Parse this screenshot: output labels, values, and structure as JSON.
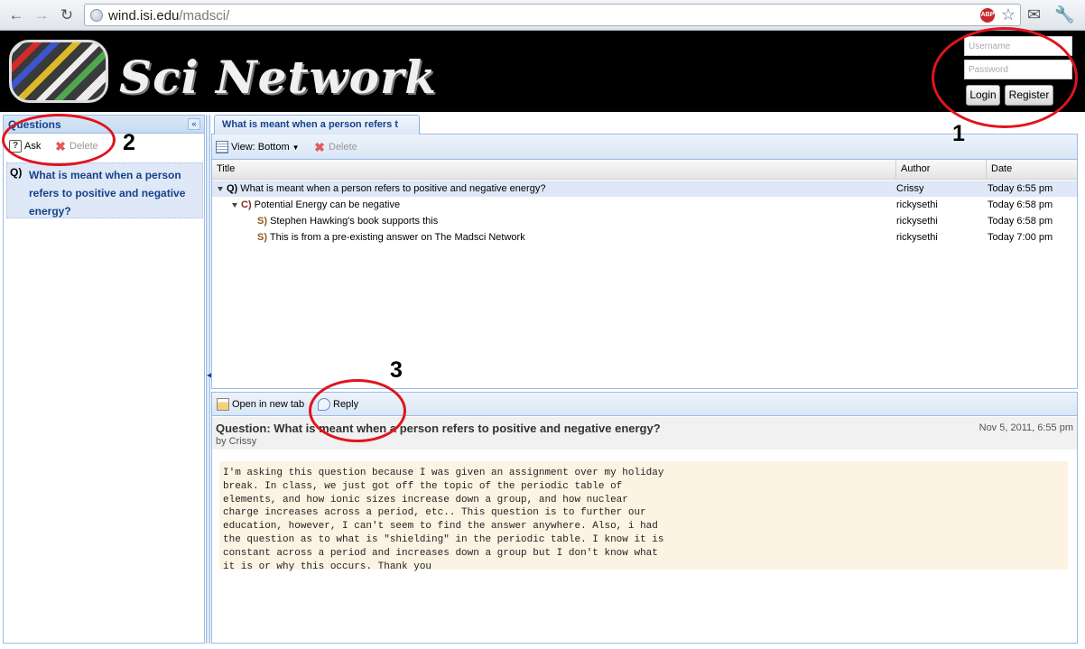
{
  "browser": {
    "url_host": "wind.isi.edu",
    "url_path": "/madsci/",
    "adblock_label": "ABP"
  },
  "banner": {
    "logo_text": "Sci Network",
    "username_placeholder": "Username",
    "password_placeholder": "Password",
    "login_label": "Login",
    "register_label": "Register"
  },
  "annotations": [
    "1",
    "2",
    "3"
  ],
  "left_panel": {
    "title": "Questions",
    "collapse_glyph": "«",
    "ask_label": "Ask",
    "delete_label": "Delete",
    "question_prefix": "Q)",
    "question_text": "What is meant when a person refers to positive and negative energy?"
  },
  "main": {
    "tab_label": "What is meant when a person refers t",
    "toolbar": {
      "view_label": "View: Bottom",
      "delete_label": "Delete"
    },
    "columns": [
      "Title",
      "Author",
      "Date"
    ],
    "rows": [
      {
        "prefix": "Q)",
        "title": "What is meant when a person refers to positive and negative energy?",
        "author": "Crissy",
        "date": "Today 6:55 pm"
      },
      {
        "prefix": "C)",
        "title": "Potential Energy can be negative",
        "author": "rickysethi",
        "date": "Today 6:58 pm"
      },
      {
        "prefix": "S)",
        "title": "Stephen Hawking's book supports this",
        "author": "rickysethi",
        "date": "Today 6:58 pm"
      },
      {
        "prefix": "S)",
        "title": "This is from a pre-existing answer on The Madsci Network",
        "author": "rickysethi",
        "date": "Today 7:00 pm"
      }
    ],
    "detail": {
      "open_tab_label": "Open in new tab",
      "reply_label": "Reply",
      "title": "Question: What is meant when a person refers to positive and negative energy?",
      "byline": "by Crissy",
      "date": "Nov 5, 2011, 6:55 pm",
      "body": "I'm asking this question because I was given an assignment over my holiday\nbreak. In class, we just got off the topic of the periodic table of\nelements, and how ionic sizes increase down a group, and how nuclear\ncharge increases across a period, etc.. This question is to further our\neducation, however, I can't seem to find the answer anywhere. Also, i had\nthe question as to what is \"shielding\" in the periodic table. I know it is\nconstant across a period and increases down a group but I don't know what\nit is or why this occurs. Thank you"
    }
  },
  "colors": {
    "annotation": "#e0141e",
    "header_blue": "#15428b",
    "selection": "#dfe8f6",
    "body_bg": "#fdf3e3"
  }
}
